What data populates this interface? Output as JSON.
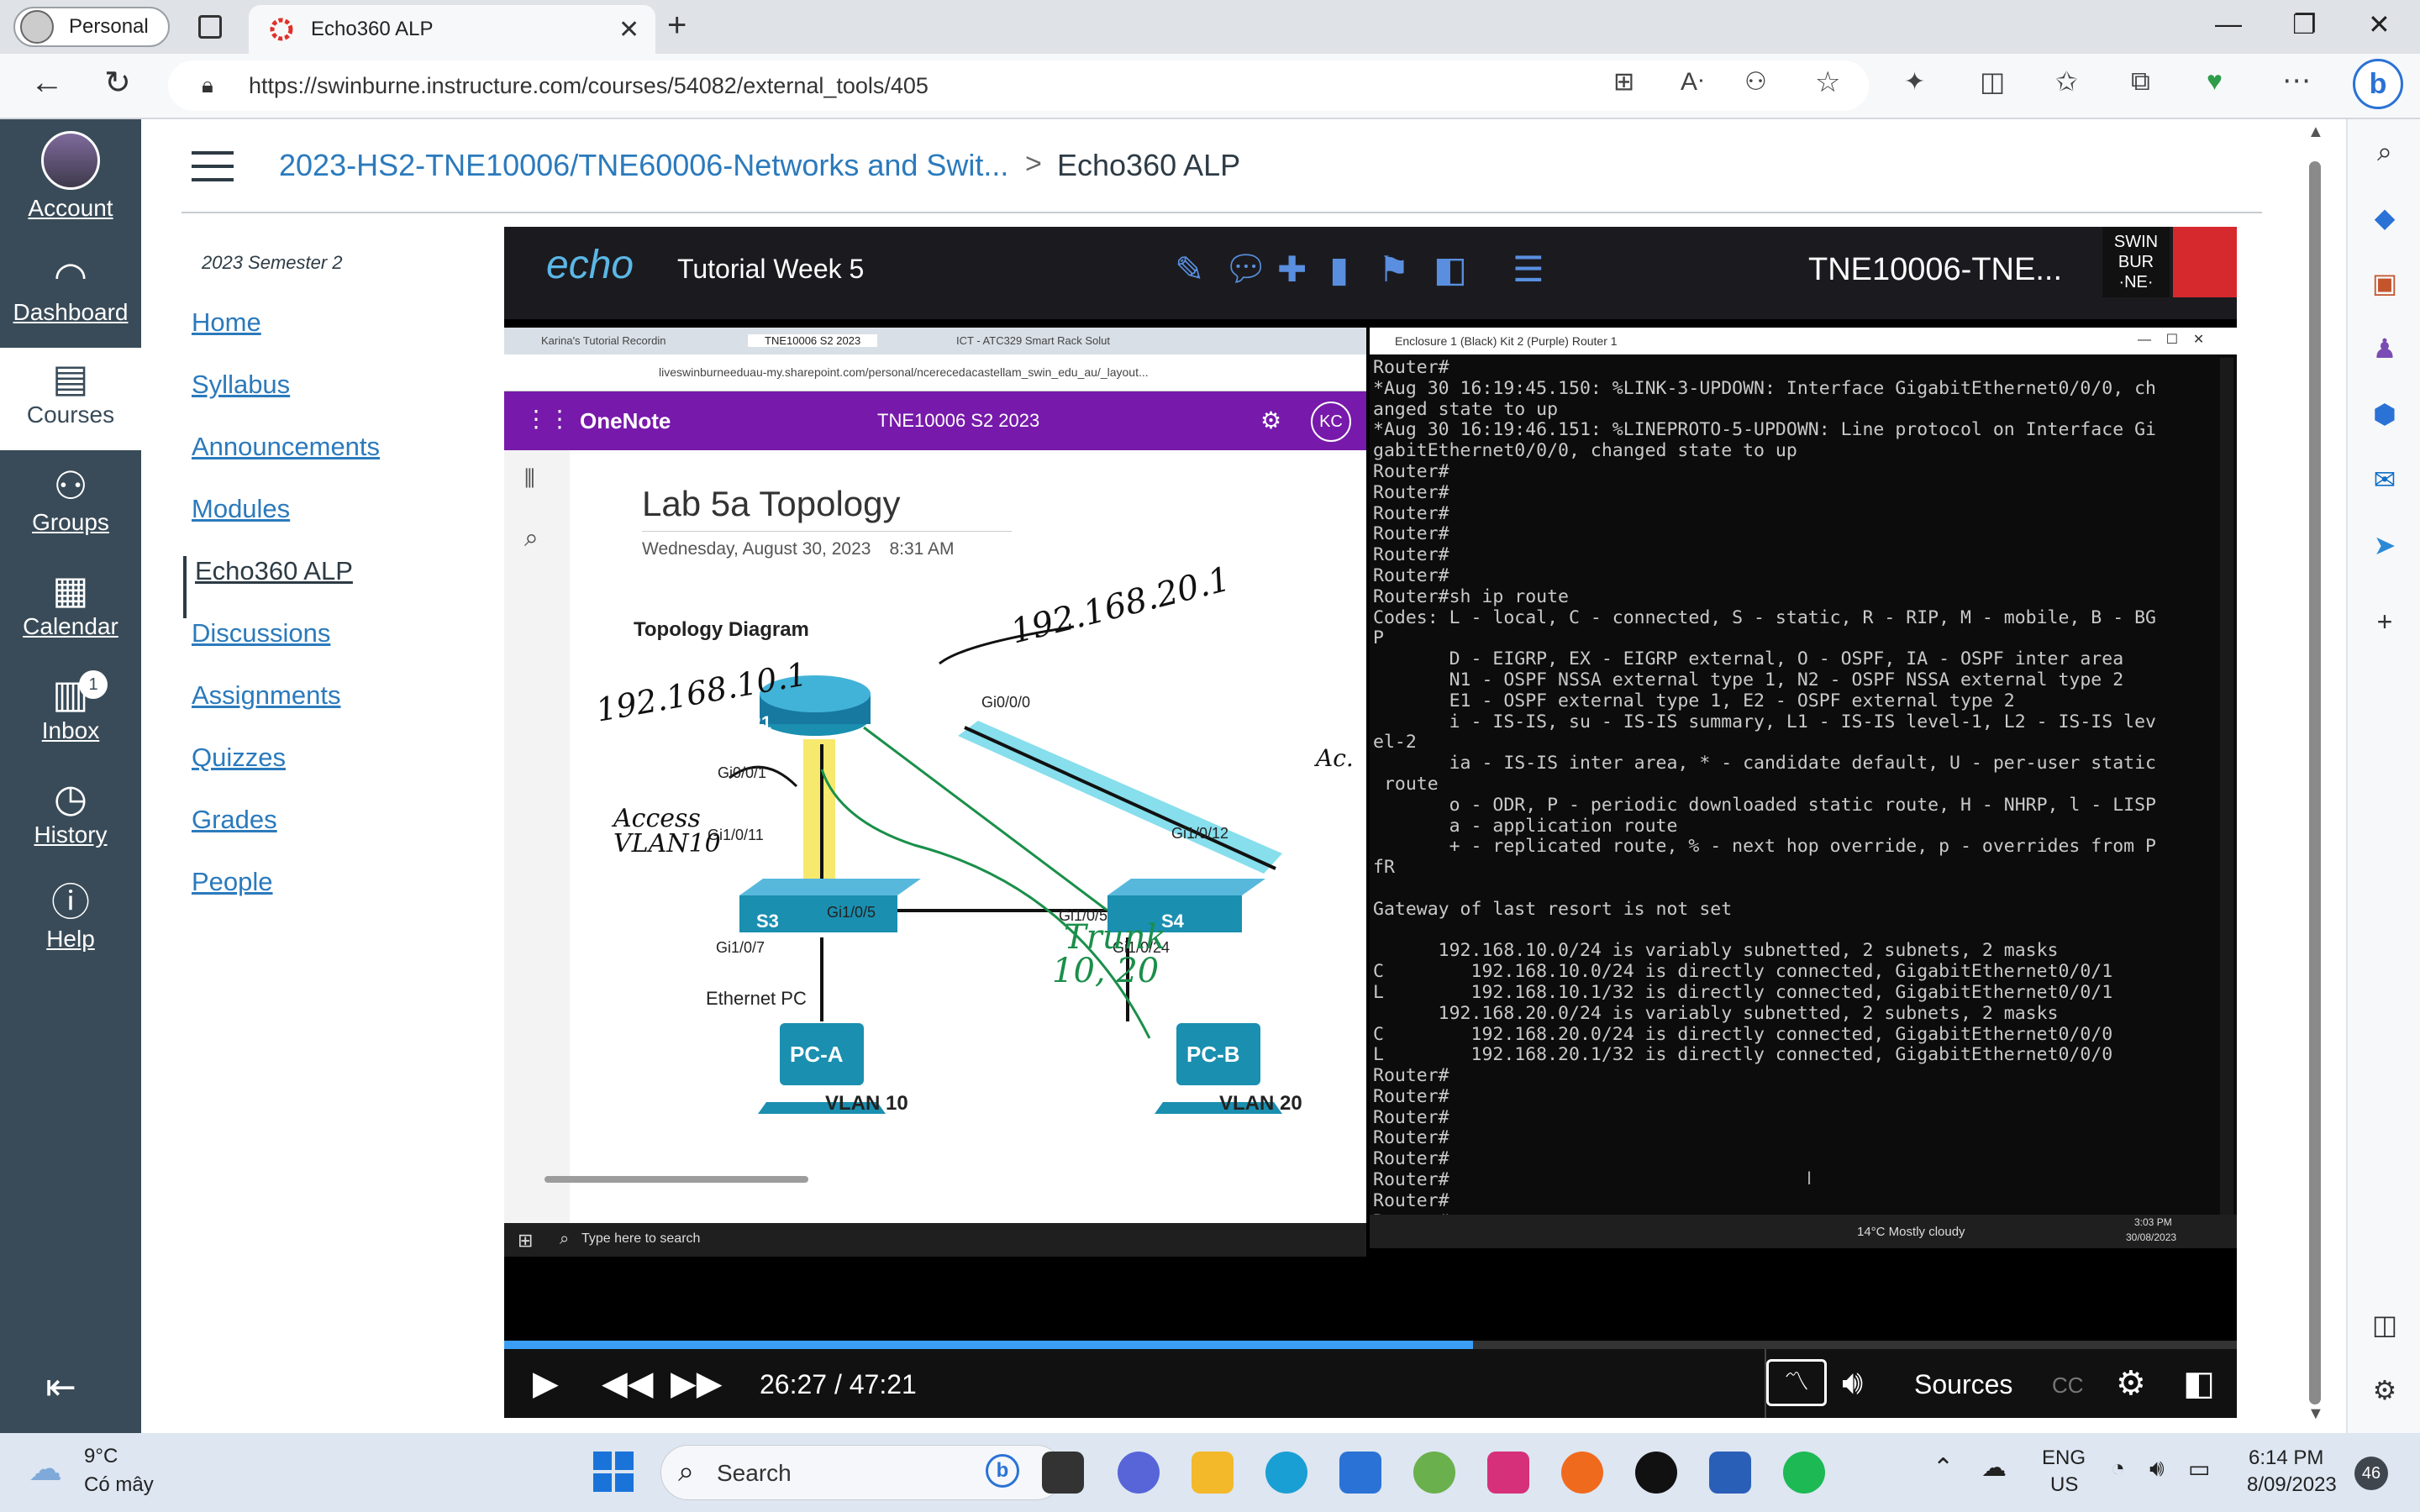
{
  "browser": {
    "profile_label": "Personal",
    "tab_title": "Echo360 ALP",
    "url": "https://swinburne.instructure.com/courses/54082/external_tools/405"
  },
  "global_nav": {
    "items": [
      {
        "label": "Account",
        "icon": "account-avatar"
      },
      {
        "label": "Dashboard",
        "icon": "dashboard-icon"
      },
      {
        "label": "Courses",
        "icon": "courses-icon"
      },
      {
        "label": "Groups",
        "icon": "groups-icon"
      },
      {
        "label": "Calendar",
        "icon": "calendar-icon"
      },
      {
        "label": "Inbox",
        "icon": "inbox-icon",
        "badge": "1"
      },
      {
        "label": "History",
        "icon": "history-icon"
      },
      {
        "label": "Help",
        "icon": "help-icon"
      }
    ]
  },
  "header": {
    "breadcrumb_course": "2023-HS2-TNE10006/TNE60006-Networks and Swit...",
    "breadcrumb_sep": ">",
    "breadcrumb_page": "Echo360 ALP"
  },
  "course_nav": {
    "semester": "2023 Semester 2",
    "items": [
      "Home",
      "Syllabus",
      "Announcements",
      "Modules",
      "Echo360 ALP",
      "Discussions",
      "Assignments",
      "Quizzes",
      "Grades",
      "People"
    ]
  },
  "player": {
    "logo": "echo",
    "lesson_title": "Tutorial Week 5",
    "course_title": "TNE10006-TNE...",
    "brand_lines": [
      "SWIN",
      "BUR",
      "·NE·"
    ],
    "progress_fraction": 0.5593,
    "time": "26:27 / 47:21",
    "sources_label": "Sources",
    "cc_label": "CC"
  },
  "video": {
    "onenote": {
      "tabs": [
        "Karina's Tutorial Recordin",
        "TNE10006 S2 2023",
        "ICT - ATC329 Smart Rack Solut"
      ],
      "address": "liveswinburneeduau-my.sharepoint.com/personal/ncerecedacastellam_swin_edu_au/_layout...",
      "app_name": "OneNote",
      "notebook": "TNE10006 S2 2023",
      "user_initials": "KC",
      "page_title": "Lab 5a Topology",
      "page_date": "Wednesday, August 30, 2023",
      "page_time": "8:31 AM",
      "diagram_title": "Topology Diagram",
      "labels": {
        "r1": "R1",
        "s3": "S3",
        "s4": "S4",
        "pca": "PC-A",
        "pcb": "PC-B",
        "gi001": "Gi0/0/1",
        "gi000": "Gi0/0/0",
        "gi1011": "Gi1/0/11",
        "gi1012": "Gi1/0/12",
        "gi105a": "Gi1/0/5",
        "gi105b": "Gi1/0/5",
        "gi107": "Gi1/0/7",
        "gi1024": "Gi1/0/24",
        "ethernet_pc": "Ethernet PC",
        "vlan10": "VLAN 10",
        "vlan20": "VLAN 20"
      },
      "annotations": {
        "ip10": "192.168.10.1",
        "ip20": "192.168.20.1",
        "access": "Access",
        "vlan": "VLAN10",
        "trunk": "Trunk",
        "trunk_vlans": "10, 20",
        "ac": "Ac."
      },
      "taskbar_search": "Type here to search",
      "taskbar_weather": "14°C  Mostly cloudy",
      "taskbar_time": "3:03 PM",
      "taskbar_date": "30/08/2023"
    },
    "terminal": {
      "title": "Enclosure 1 (Black) Kit 2 (Purple) Router 1",
      "lines": [
        "Router#",
        "*Aug 30 16:19:45.150: %LINK-3-UPDOWN: Interface GigabitEthernet0/0/0, ch",
        "anged state to up",
        "*Aug 30 16:19:46.151: %LINEPROTO-5-UPDOWN: Line protocol on Interface Gi",
        "gabitEthernet0/0/0, changed state to up",
        "Router#",
        "Router#",
        "Router#",
        "Router#",
        "Router#",
        "Router#",
        "Router#sh ip route",
        "Codes: L - local, C - connected, S - static, R - RIP, M - mobile, B - BG",
        "P",
        "       D - EIGRP, EX - EIGRP external, O - OSPF, IA - OSPF inter area",
        "       N1 - OSPF NSSA external type 1, N2 - OSPF NSSA external type 2",
        "       E1 - OSPF external type 1, E2 - OSPF external type 2",
        "       i - IS-IS, su - IS-IS summary, L1 - IS-IS level-1, L2 - IS-IS lev",
        "el-2",
        "       ia - IS-IS inter area, * - candidate default, U - per-user static",
        " route",
        "       o - ODR, P - periodic downloaded static route, H - NHRP, l - LISP",
        "       a - application route",
        "       + - replicated route, % - next hop override, p - overrides from P",
        "fR",
        "",
        "Gateway of last resort is not set",
        "",
        "      192.168.10.0/24 is variably subnetted, 2 subnets, 2 masks",
        "C        192.168.10.0/24 is directly connected, GigabitEthernet0/0/1",
        "L        192.168.10.1/32 is directly connected, GigabitEthernet0/0/1",
        "      192.168.20.0/24 is variably subnetted, 2 subnets, 2 masks",
        "C        192.168.20.0/24 is directly connected, GigabitEthernet0/0/0",
        "L        192.168.20.1/32 is directly connected, GigabitEthernet0/0/0",
        "Router#",
        "Router#",
        "Router#",
        "Router#",
        "Router#",
        "Router#",
        "Router#",
        "Router#",
        "Router#"
      ]
    }
  },
  "taskbar": {
    "weather_temp": "9°C",
    "weather_desc": "Có mây",
    "search_placeholder": "Search",
    "lang_line1": "ENG",
    "lang_line2": "US",
    "time": "6:14 PM",
    "date": "8/09/2023",
    "notification_count": "46"
  },
  "colors": {
    "canvas_nav": "#394b58",
    "link": "#2b7abc",
    "onenote_purple": "#7719aa",
    "echo_blue": "#5bb7e6",
    "progress": "#3a9ff4",
    "trunk_highlight": "#5fd3e6",
    "access_highlight": "#f5e44a"
  }
}
